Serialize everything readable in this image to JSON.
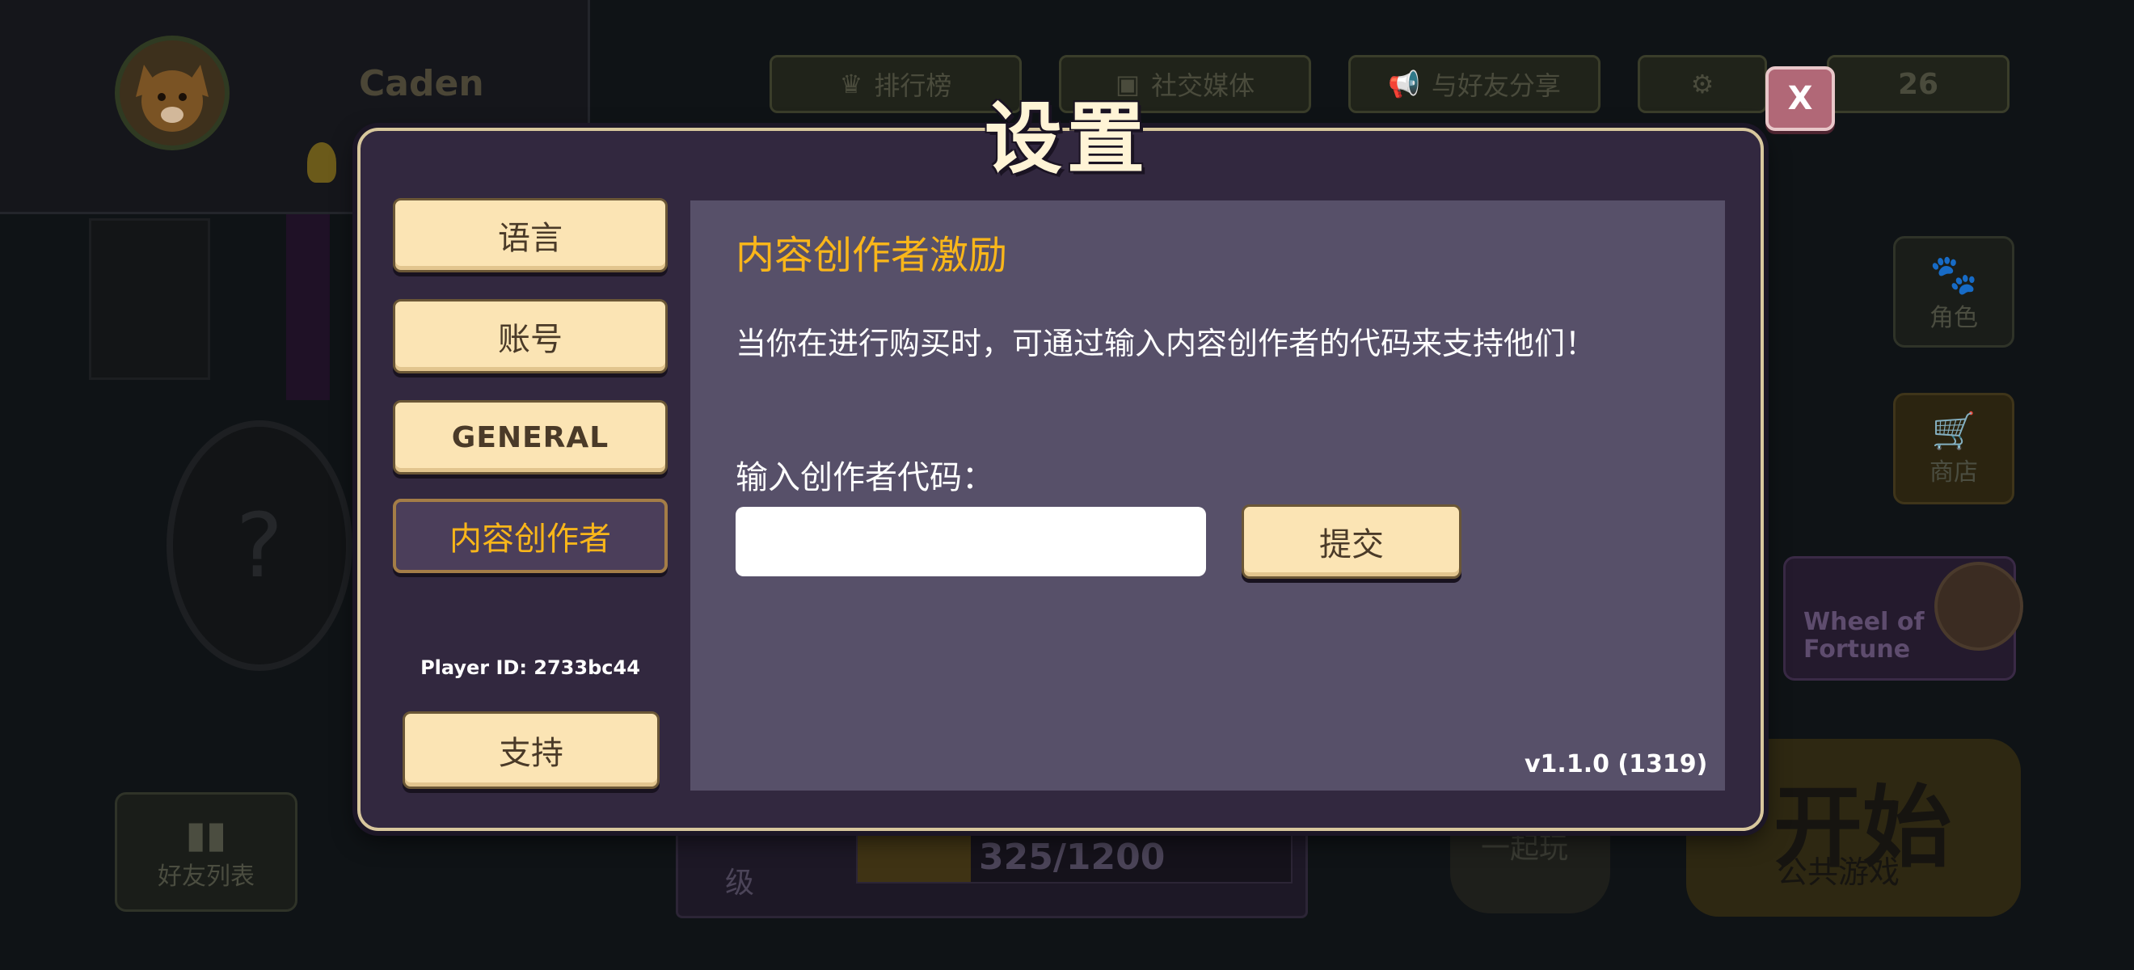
{
  "background": {
    "player_name": "Caden",
    "top_buttons": [
      "排行榜",
      "社交媒体",
      "与好友分享"
    ],
    "coins": "26",
    "side_buttons": [
      "角色",
      "商店"
    ],
    "wheel_label": "Wheel of Fortune",
    "friends_list": "好友列表",
    "level_label": "级",
    "xp": "325/1200",
    "play_together": "一起玩",
    "start_big": "开始",
    "start_sub": "公共游戏"
  },
  "modal": {
    "title": "设置",
    "close_label": "X",
    "menu": [
      {
        "label": "语言",
        "active": false
      },
      {
        "label": "账号",
        "active": false
      },
      {
        "label": "GENERAL",
        "active": false
      },
      {
        "label": "内容创作者",
        "active": true
      }
    ],
    "player_id": "Player ID: 2733bc44",
    "support_label": "支持",
    "content": {
      "heading": "内容创作者激励",
      "description": "当你在进行购买时，可通过输入内容创作者的代码来支持他们！",
      "code_label": "输入创作者代码：",
      "code_value": "",
      "submit_label": "提交",
      "version": "v1.1.0 (1319)"
    }
  },
  "colors": {
    "accent_gold": "#f9b61a",
    "button_cream": "#fbe4b4",
    "panel_purple": "#32283f",
    "content_purple": "#575069"
  }
}
